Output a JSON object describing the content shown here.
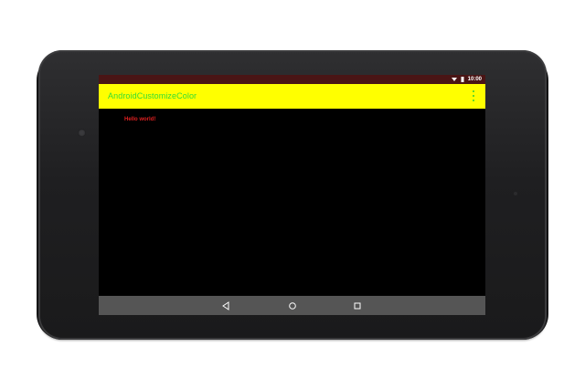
{
  "status_bar": {
    "time": "10:00",
    "background": "#4a1515",
    "icons": [
      "wifi-icon",
      "battery-icon"
    ]
  },
  "app_bar": {
    "title": "AndroidCustomizeColor",
    "background": "#ffff00",
    "title_color": "#33dd33",
    "menu_icon": "overflow-menu-icon"
  },
  "content": {
    "text": "Hello world!",
    "text_color": "#e02020",
    "background": "#000000"
  },
  "nav_bar": {
    "background": "#555555",
    "buttons": [
      "back-icon",
      "home-icon",
      "recents-icon"
    ]
  }
}
